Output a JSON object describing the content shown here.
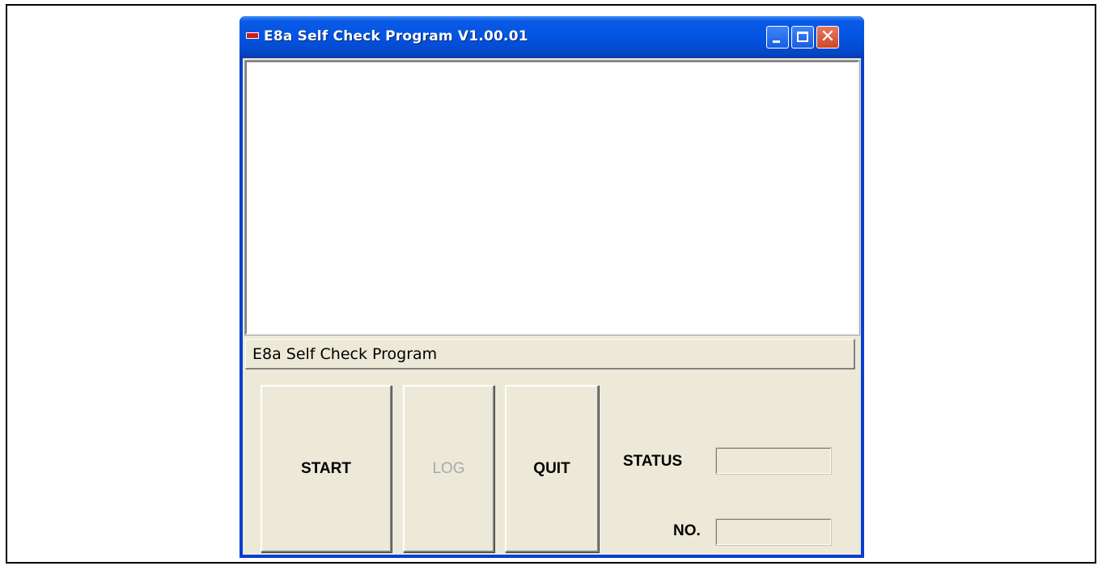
{
  "window": {
    "title": "E8a Self Check Program V1.00.01",
    "icon": "app-icon",
    "controls": {
      "minimize": "minimize-icon",
      "maximize": "maximize-icon",
      "close_glyph": "✕"
    }
  },
  "log": {
    "content": ""
  },
  "status_bar": {
    "text": "E8a Self Check Program"
  },
  "buttons": {
    "start": "START",
    "log": "LOG",
    "quit": "QUIT"
  },
  "fields": {
    "status_label": "STATUS",
    "status_value": "",
    "no_label": "NO.",
    "no_value": ""
  },
  "colors": {
    "titlebar": "#0354e3",
    "client": "#ece9d8",
    "close_button": "#cc4a28",
    "disabled_text": "#a8a8a8"
  }
}
